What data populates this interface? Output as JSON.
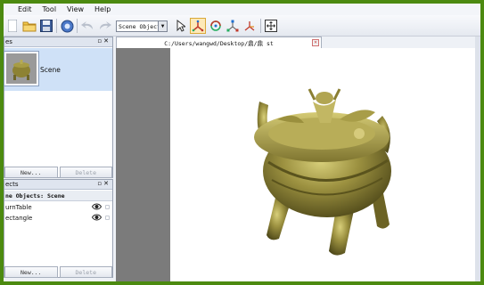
{
  "menu": {
    "items": [
      "Edit",
      "Tool",
      "View",
      "Help"
    ]
  },
  "toolbar": {
    "mode_select": "Scene Object",
    "buttons": [
      "open-folder-icon",
      "save-icon",
      "render-icon",
      "undo-icon",
      "redo-icon",
      "select-arrow-icon",
      "move-axis-icon",
      "rotate-icon",
      "scale-icon",
      "axis-icon",
      "fit-view-icon"
    ],
    "active": "move-axis-icon",
    "accent": "#fde9b8"
  },
  "scenes_panel": {
    "title": "es",
    "items": [
      {
        "label": "Scene"
      }
    ],
    "new_label": "New...",
    "delete_label": "Delete"
  },
  "objects_panel": {
    "title": "ects",
    "header": "ne Objects: Scene",
    "items": [
      {
        "label": "urnTable"
      },
      {
        "label": "ectangle"
      }
    ],
    "new_label": "New...",
    "delete_label": "Delete"
  },
  "document": {
    "tab_title": "C:/Users/wangwd/Desktop/鼎/鼎 st",
    "close_label": "✕"
  },
  "colors": {
    "frame_border": "#4c8a10",
    "selection": "#cfe1f7",
    "viewport_bg": "#ffffff",
    "gutter": "#7b7b7b",
    "bronze": "#8f8a3a"
  }
}
